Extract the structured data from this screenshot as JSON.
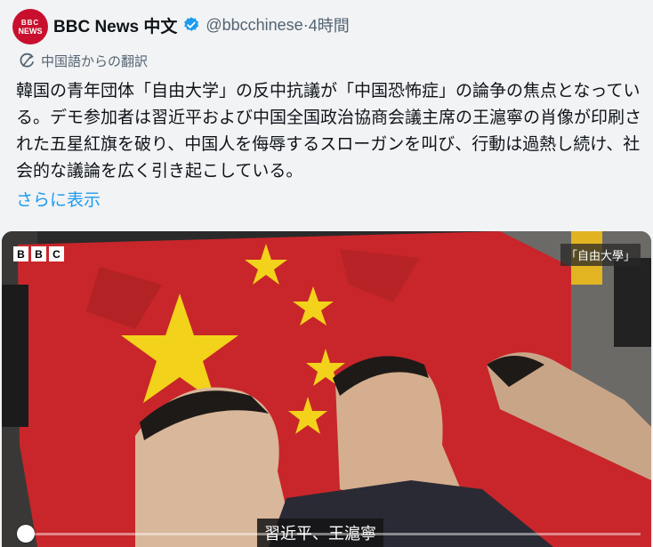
{
  "tweet": {
    "avatar_logo": "BBC",
    "avatar_sub": "NEWS",
    "author_name": "BBC News 中文",
    "handle": "@bbcchinese",
    "separator": " · ",
    "time": "4時間",
    "translation_label": "中国語からの翻訳",
    "text": "韓国の青年団体「自由大学」の反中抗議が「中国恐怖症」の論争の焦点となっている。デモ参加者は習近平および中国全国政治協商会議主席の王滬寧の肖像が印刷された五星紅旗を破り、中国人を侮辱するスローガンを叫び、行動は過熱し続け、社会的な議論を広く引き起こしている。",
    "show_more": "さらに表示"
  },
  "media": {
    "logo_letters": [
      "B",
      "B",
      "C"
    ],
    "corner_tag": "「自由大學」",
    "caption": "習近平、王滬寧",
    "progress": 0.02
  },
  "colors": {
    "verified": "#1d9bf0",
    "link": "#1d9bf0",
    "brand": "#c8102e",
    "flag_red": "#c8262a",
    "star_yellow": "#f2d21a"
  },
  "icons": {
    "verified": "verified-badge-icon",
    "translate": "translate-icon"
  }
}
